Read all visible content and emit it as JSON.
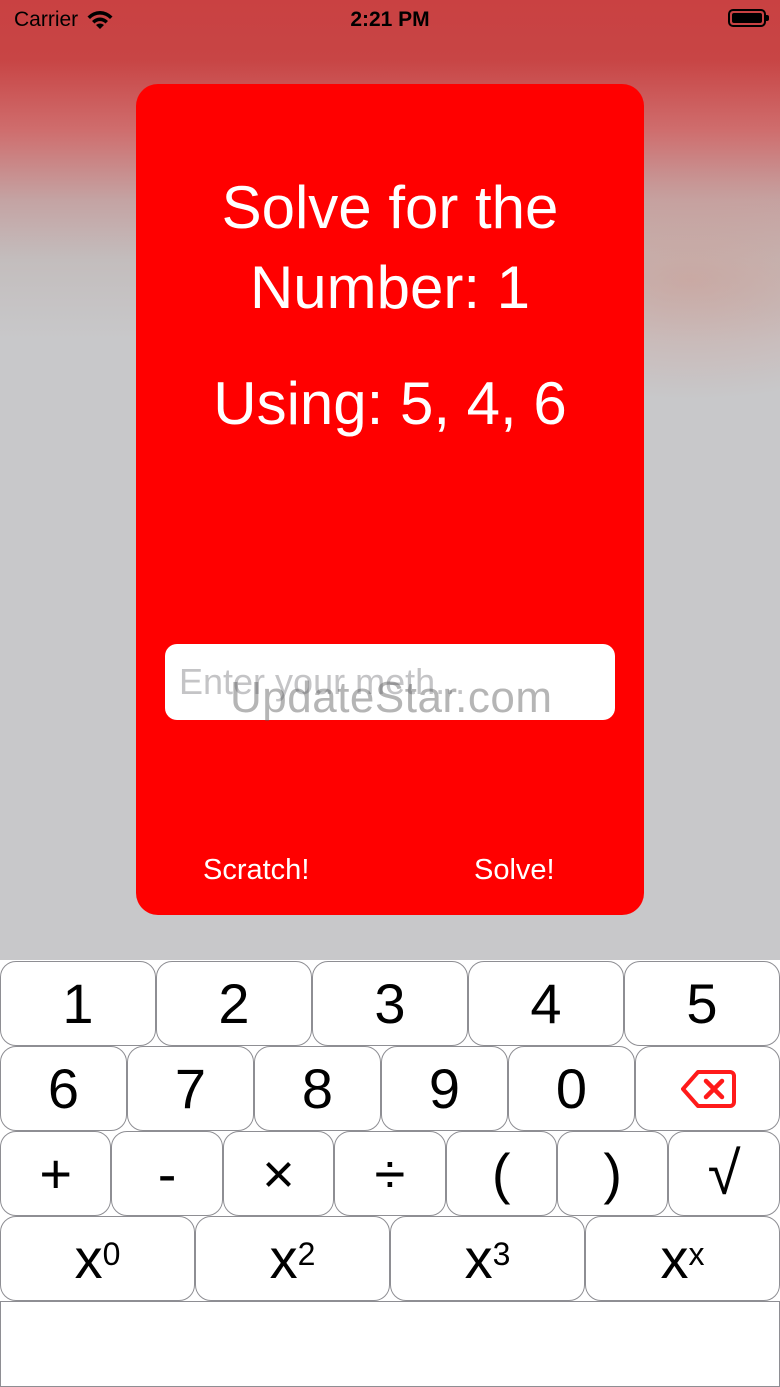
{
  "status_bar": {
    "carrier": "Carrier",
    "time": "2:21 PM"
  },
  "card": {
    "title_line1": "Solve for the",
    "title_line2": "Number: 1",
    "using": "Using: 5, 4, 6",
    "input_placeholder": "Enter your meth...",
    "scratch_label": "Scratch!",
    "solve_label": "Solve!"
  },
  "watermark": "UpdateStar.com",
  "keyboard": {
    "row1": [
      "1",
      "2",
      "3",
      "4",
      "5"
    ],
    "row2": [
      "6",
      "7",
      "8",
      "9",
      "0"
    ],
    "row3": [
      "+",
      "-",
      "×",
      "÷",
      "(",
      ")",
      "√"
    ],
    "row4": [
      {
        "base": "x",
        "exp": "0"
      },
      {
        "base": "x",
        "exp": "2"
      },
      {
        "base": "x",
        "exp": "3"
      },
      {
        "base": "x",
        "exp": "x"
      }
    ]
  },
  "colors": {
    "card": "#ff0000",
    "backspace": "#ff1a1a"
  }
}
